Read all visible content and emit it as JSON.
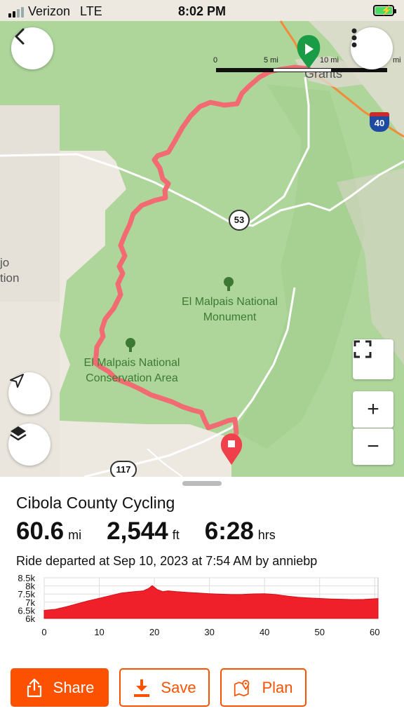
{
  "status_bar": {
    "carrier": "Verizon",
    "network": "LTE",
    "time": "8:02 PM",
    "battery_charging": true
  },
  "map": {
    "scale": {
      "labels": [
        "0",
        "5 mi",
        "10 mi",
        "mi"
      ]
    },
    "place_labels": {
      "town": "Grants",
      "monument": "El Malpais National\nMonument",
      "conservation": "El Malpais National\nConservation Area",
      "edge_text": "jo\ntion"
    },
    "shields": {
      "interstate": "40",
      "route_a": "53",
      "route_b": "117"
    },
    "icons": {
      "back": "back-arrow-icon",
      "menu": "more-vertical-icon",
      "locate": "navigation-arrow-icon",
      "layers": "layers-icon",
      "fullscreen": "fullscreen-icon",
      "zoom_in": "+",
      "zoom_out": "−"
    },
    "colors": {
      "route": "#f26b72",
      "start": "#1a9c46",
      "end": "#f0404b",
      "land": "#aed69b"
    }
  },
  "ride": {
    "title": "Cibola County Cycling",
    "distance": {
      "value": "60.6",
      "unit": "mi"
    },
    "elevation": {
      "value": "2,544",
      "unit": "ft"
    },
    "time": {
      "value": "6:28",
      "unit": "hrs"
    },
    "departed_text": "Ride departed at Sep 10, 2023 at 7:54 AM by anniebp"
  },
  "chart_data": {
    "type": "area",
    "title": "",
    "xlabel": "",
    "ylabel": "",
    "x_ticks": [
      "0",
      "10",
      "20",
      "30",
      "40",
      "50",
      "60"
    ],
    "y_ticks": [
      "8.5k",
      "8k",
      "7.5k",
      "7k",
      "6.5k",
      "6k"
    ],
    "xlim": [
      0,
      60.6
    ],
    "ylim": [
      6000,
      8500
    ],
    "grid": true,
    "color": "#f0202a",
    "x": [
      0,
      2,
      4,
      6,
      8,
      10,
      12,
      14,
      16,
      18,
      19,
      19.6,
      20.5,
      21.5,
      22.5,
      24,
      26,
      28,
      30,
      32,
      34,
      36,
      38,
      40,
      42,
      44,
      46,
      48,
      50,
      52,
      54,
      56,
      58,
      60.6
    ],
    "y": [
      6500,
      6560,
      6720,
      6900,
      7080,
      7240,
      7400,
      7560,
      7640,
      7700,
      7850,
      8020,
      7780,
      7650,
      7700,
      7650,
      7600,
      7560,
      7520,
      7490,
      7470,
      7480,
      7510,
      7520,
      7470,
      7380,
      7300,
      7260,
      7230,
      7200,
      7180,
      7160,
      7170,
      7220
    ]
  },
  "actions": {
    "share": {
      "label": "Share",
      "icon": "share-icon"
    },
    "save": {
      "label": "Save",
      "icon": "download-icon"
    },
    "plan": {
      "label": "Plan",
      "icon": "map-pin-icon"
    }
  }
}
